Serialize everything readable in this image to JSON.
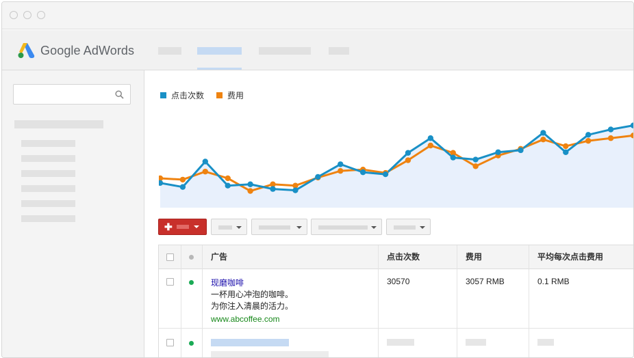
{
  "app": {
    "brand": "Google AdWords"
  },
  "colors": {
    "clicks": "#1990c6",
    "cost": "#ef8310",
    "area_fill": "#e8f0fc",
    "add_button": "#c8302b",
    "status_active": "#1aaa55",
    "ad_title": "#1a0dab",
    "ad_url": "#17881a"
  },
  "search": {
    "icon": "search-icon",
    "value": "",
    "placeholder": ""
  },
  "chart_data": {
    "type": "line",
    "legend_position": "top-left",
    "grid": false,
    "x": [
      1,
      2,
      3,
      4,
      5,
      6,
      7,
      8,
      9,
      10,
      11,
      12,
      13,
      14,
      15,
      16,
      17,
      18,
      19,
      20,
      21,
      22
    ],
    "series": [
      {
        "name": "点击次数",
        "color": "#1990c6",
        "values": [
          37,
          31,
          69,
          33,
          35,
          28,
          26,
          46,
          65,
          53,
          50,
          82,
          104,
          75,
          72,
          83,
          86,
          112,
          83,
          109,
          117,
          123
        ]
      },
      {
        "name": "费用",
        "color": "#ef8310",
        "values": [
          44,
          42,
          54,
          44,
          25,
          35,
          33,
          45,
          55,
          57,
          52,
          71,
          93,
          82,
          62,
          78,
          88,
          102,
          92,
          100,
          104,
          108
        ]
      }
    ],
    "ylim": [
      0,
      140
    ]
  },
  "toolbar": {
    "add_icon": "plus-icon"
  },
  "table": {
    "columns": [
      "广告",
      "点击次数",
      "费用",
      "平均每次点击费用"
    ],
    "rows": [
      {
        "status": "active",
        "ad": {
          "title": "现磨咖啡",
          "line1": "一杯用心冲泡的咖啡。",
          "line2": "为你注入清晨的活力。",
          "url": "www.abcoffee.com"
        },
        "clicks": "30570",
        "cost": "3057 RMB",
        "avg_cpc": "0.1 RMB"
      }
    ]
  }
}
